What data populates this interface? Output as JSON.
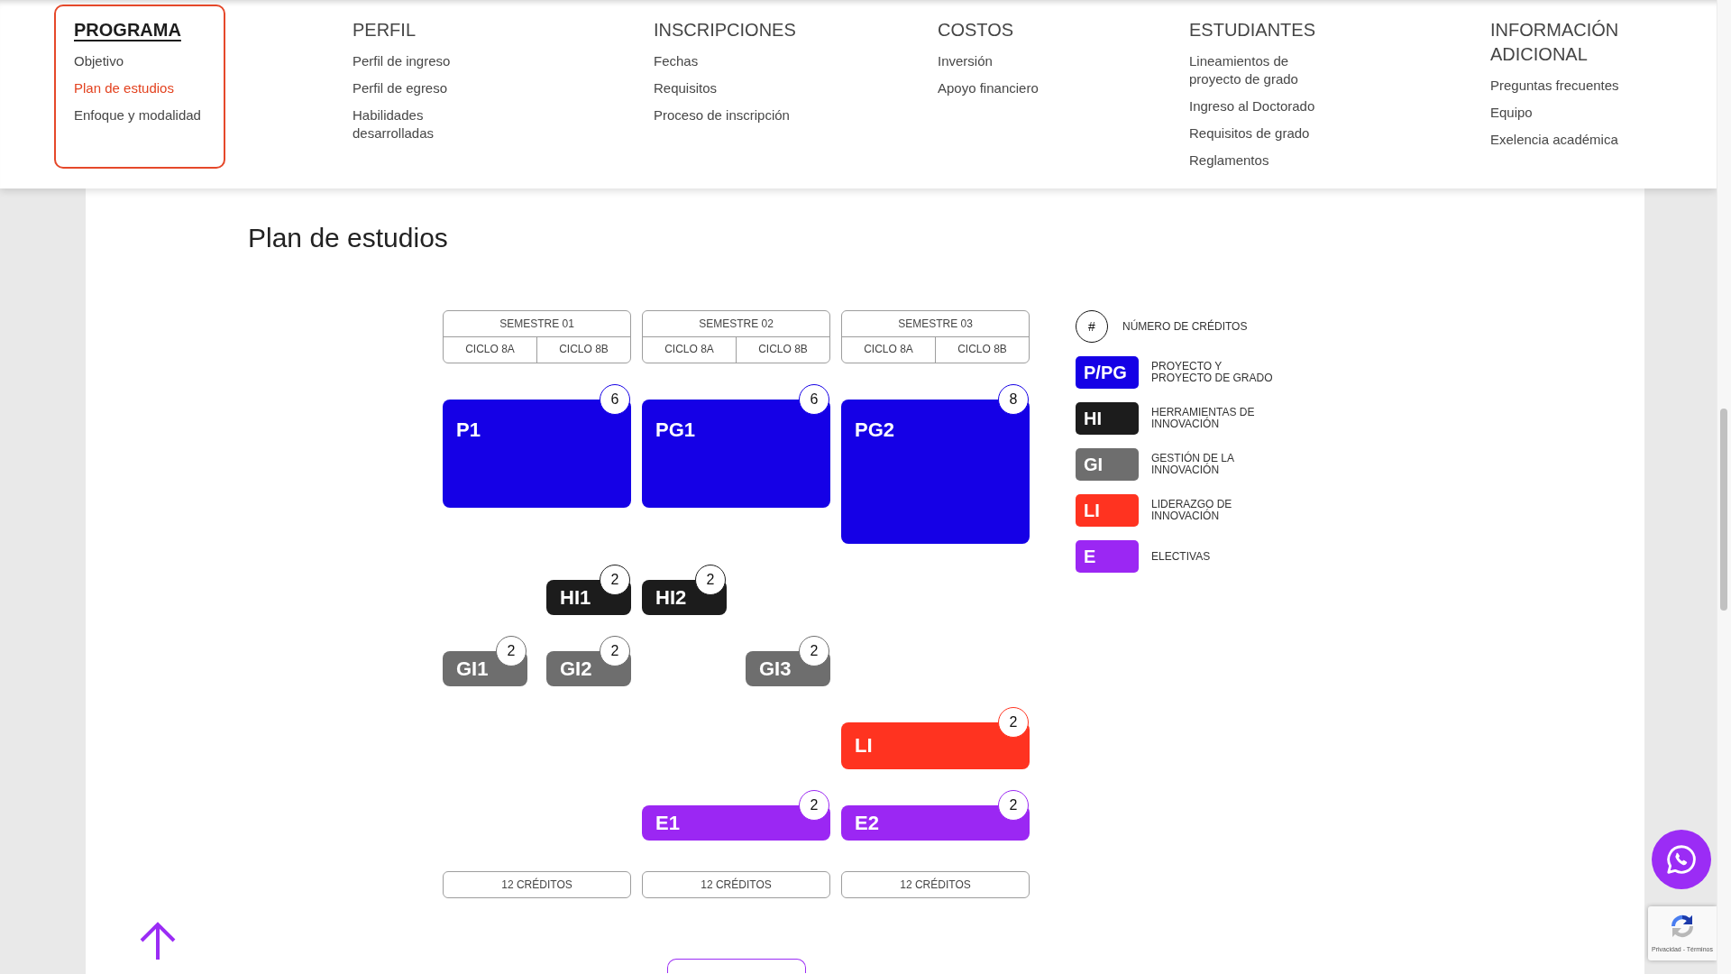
{
  "menu": [
    {
      "title": "PROGRAMA",
      "selected": true,
      "items": [
        {
          "label": "Objetivo",
          "selected": false
        },
        {
          "label": "Plan de estudios",
          "selected": true
        },
        {
          "label": "Enfoque y modalidad",
          "selected": false
        }
      ]
    },
    {
      "title": "PERFIL",
      "selected": false,
      "items": [
        {
          "label": "Perfil de ingreso",
          "selected": false
        },
        {
          "label": "Perfil de egreso",
          "selected": false
        },
        {
          "label": "Habilidades desarrolladas",
          "selected": false
        }
      ]
    },
    {
      "title": "INSCRIPCIONES",
      "selected": false,
      "items": [
        {
          "label": "Fechas",
          "selected": false
        },
        {
          "label": "Requisitos",
          "selected": false
        },
        {
          "label": "Proceso de inscripción",
          "selected": false
        }
      ]
    },
    {
      "title": "COSTOS",
      "selected": false,
      "items": [
        {
          "label": "Inversión",
          "selected": false
        },
        {
          "label": "Apoyo financiero",
          "selected": false
        }
      ]
    },
    {
      "title": "ESTUDIANTES",
      "selected": false,
      "items": [
        {
          "label": "Lineamientos de proyecto de grado",
          "selected": false
        },
        {
          "label": "Ingreso al Doctorado",
          "selected": false
        },
        {
          "label": "Requisitos de grado",
          "selected": false
        },
        {
          "label": "Reglamentos",
          "selected": false
        }
      ]
    },
    {
      "title": "INFORMACIÓN ADICIONAL",
      "selected": false,
      "items": [
        {
          "label": "Preguntas frecuentes",
          "selected": false
        },
        {
          "label": "Equipo",
          "selected": false
        },
        {
          "label": "Exelencia académica",
          "selected": false
        }
      ]
    }
  ],
  "page_title": "Plan de estudios",
  "plan": {
    "semesters": [
      {
        "title": "SEMESTRE 01",
        "cycles": [
          {
            "label": "CICLO 8A",
            "courses": [
              {
                "code": "GI1",
                "credits": "2",
                "kind": "management",
                "color": "#6e6e6e"
              }
            ]
          },
          {
            "label": "CICLO 8B",
            "courses": [
              {
                "code": "HI1",
                "credits": "2",
                "kind": "tools",
                "color": "#1c1c1c"
              },
              {
                "code": "GI2",
                "credits": "2",
                "kind": "management",
                "color": "#6e6e6e"
              }
            ]
          }
        ],
        "courses": [
          {
            "code": "P1",
            "credits": "6",
            "kind": "project",
            "color": "#1500e6"
          }
        ],
        "total": "12 CRÉDITOS"
      },
      {
        "title": "SEMESTRE 02",
        "cycles": [
          {
            "label": "CICLO 8A",
            "courses": [
              {
                "code": "HI2",
                "credits": "2",
                "kind": "tools",
                "color": "#1c1c1c"
              }
            ]
          },
          {
            "label": "CICLO 8B",
            "courses": [
              {
                "code": "GI3",
                "credits": "2",
                "kind": "management",
                "color": "#6e6e6e"
              }
            ]
          }
        ],
        "courses": [
          {
            "code": "PG1",
            "credits": "6",
            "kind": "project",
            "color": "#1500e6"
          },
          {
            "code": "E1",
            "credits": "2",
            "kind": "elective",
            "color": "#9b27f3"
          }
        ],
        "total": "12 CRÉDITOS"
      },
      {
        "title": "SEMESTRE 03",
        "cycles": [
          {
            "label": "CICLO 8A"
          },
          {
            "label": "CICLO 8B"
          }
        ],
        "courses": [
          {
            "code": "PG2",
            "credits": "8",
            "kind": "project",
            "color": "#1500e6"
          },
          {
            "code": "LI",
            "credits": "2",
            "kind": "leadership",
            "color": "#ff3320"
          },
          {
            "code": "E2",
            "credits": "2",
            "kind": "elective",
            "color": "#9b27f3"
          }
        ],
        "total": "12 CRÉDITOS"
      }
    ]
  },
  "legend": [
    {
      "kind": "credits",
      "symbol": "#",
      "label": "NÚMERO DE CRÉDITOS"
    },
    {
      "kind": "category",
      "symbol": "P/PG",
      "label": "PROYECTO Y PROYECTO DE GRADO",
      "color": "#1500e6"
    },
    {
      "kind": "category",
      "symbol": "HI",
      "label": "HERRAMIENTAS DE INNOVACIÓN",
      "color": "#1c1c1c"
    },
    {
      "kind": "category",
      "symbol": "GI",
      "label": "GESTIÓN DE LA INNOVACIÓN",
      "color": "#6e6e6e"
    },
    {
      "kind": "category",
      "symbol": "LI",
      "label": "LIDERAZGO DE INNOVACIÓN",
      "color": "#ff3320"
    },
    {
      "kind": "category",
      "symbol": "E",
      "label": "ELECTIVAS",
      "color": "#9b27f3"
    }
  ],
  "recaptcha": {
    "links": "Privacidad - Términos"
  }
}
